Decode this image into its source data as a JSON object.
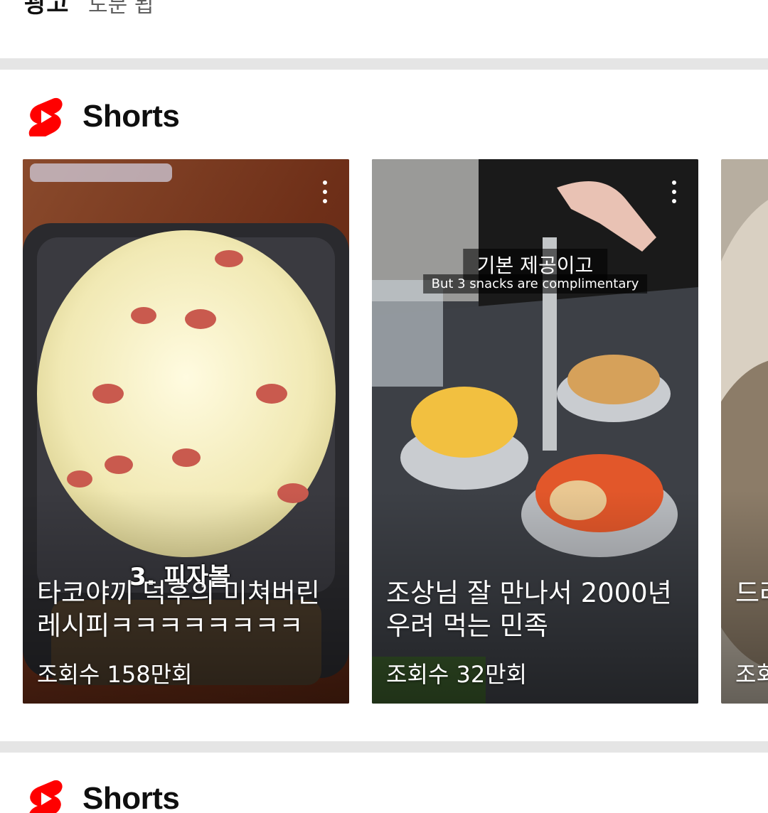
{
  "previous_section": {
    "title": "광고",
    "subtitle": "도문 됩"
  },
  "shelves": [
    {
      "title": "Shorts",
      "items": [
        {
          "title": "타코야끼 덕후의 미쳐버린 레시피ㅋㅋㅋㅋㅋㅋㅋㅋㅋ...",
          "views": "조회수 158만회",
          "overlay_text": "3. 피자볼"
        },
        {
          "title": "조상님 잘 만나서 2000년 우려 먹는 민족",
          "views": "조회수 32만회",
          "caption_ko": "기본 제공이고",
          "caption_en": "But 3 snacks are complimentary"
        },
        {
          "title": "드라 아기",
          "views": "조회"
        }
      ]
    },
    {
      "title": "Shorts"
    }
  ],
  "colors": {
    "shorts_red": "#ff0000",
    "divider": "#e5e5e5"
  }
}
